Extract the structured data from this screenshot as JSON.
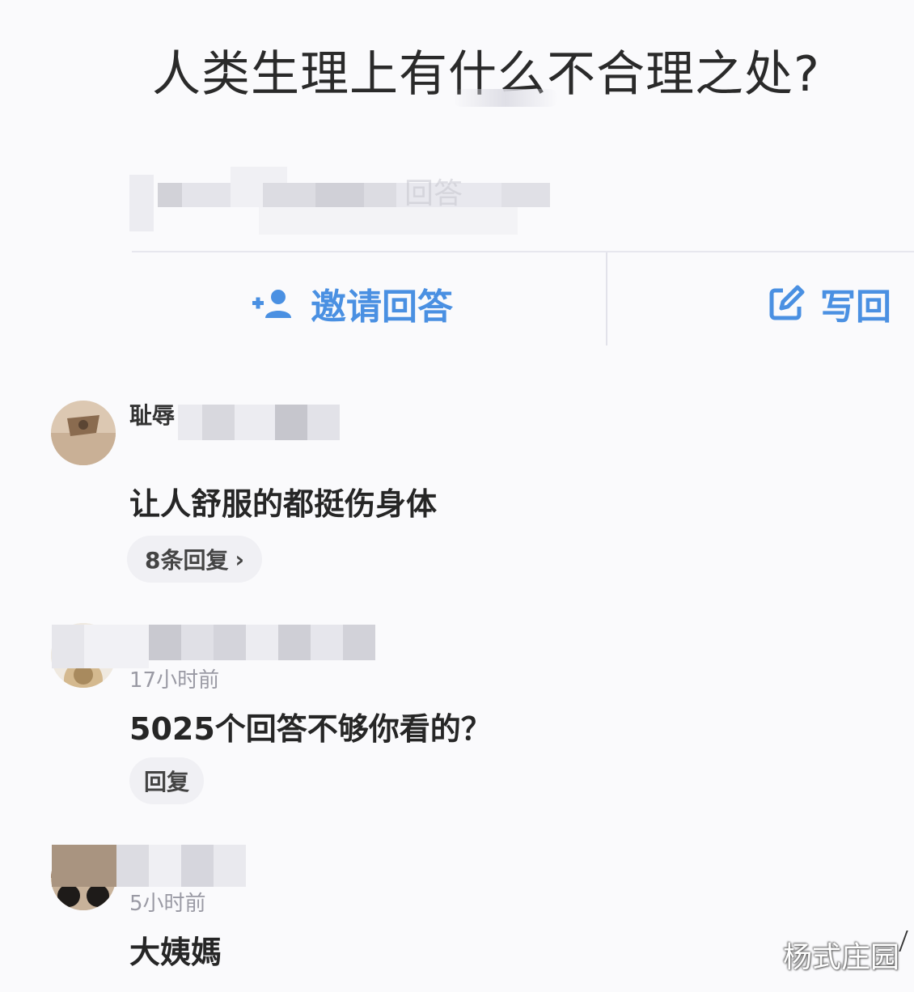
{
  "question": {
    "title": "人类生理上有什么不合理之处?",
    "meta_visible_fragment": "回答"
  },
  "actions": {
    "invite_label": "邀请回答",
    "write_label": "写回",
    "accent_color": "#4a90e2"
  },
  "comments": [
    {
      "name_fragment": "耻辱",
      "time": "",
      "content": "让人舒服的都挺伤身体",
      "reply_label": "8条回复"
    },
    {
      "name_fragment": "",
      "time": "17小时前",
      "content": "5025个回答不够你看的？",
      "reply_label": "回复"
    },
    {
      "name_fragment": "",
      "time": "5小时前",
      "content": "大姨媽",
      "reply_label": ""
    }
  ],
  "watermark": "杨式庄园"
}
